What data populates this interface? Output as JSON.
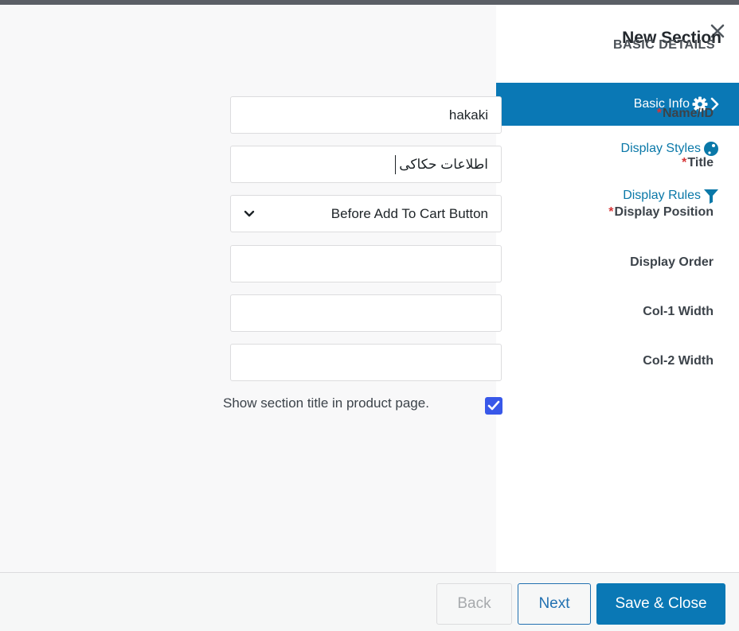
{
  "modal": {
    "title": "New Section",
    "section_heading": "BASIC DETAILS"
  },
  "nav": {
    "items": [
      {
        "label": "Basic Info",
        "icon": "gear-icon",
        "active": true
      },
      {
        "label": "Display Styles",
        "icon": "palette-icon",
        "active": false
      },
      {
        "label": "Display Rules",
        "icon": "funnel-icon",
        "active": false
      }
    ]
  },
  "form": {
    "fields": [
      {
        "label": "Name/ID",
        "required": true,
        "value": "hakaki"
      },
      {
        "label": "Title",
        "required": true,
        "value": "اطلاعات حکاکی"
      },
      {
        "label": "Display Position",
        "required": true,
        "value": "Before Add To Cart Button"
      },
      {
        "label": "Display Order",
        "required": false,
        "value": ""
      },
      {
        "label": "Col-1 Width",
        "required": false,
        "value": ""
      },
      {
        "label": "Col-2 Width",
        "required": false,
        "value": ""
      }
    ],
    "required_marker": "*",
    "show_title_label": "Show section title in product page.",
    "show_title_checked": true
  },
  "footer": {
    "back_label": "Back",
    "next_label": "Next",
    "save_label": "Save & Close"
  },
  "colors": {
    "accent": "#0a78b5",
    "checkbox": "#3858e9",
    "required": "#d63638",
    "nav_link": "#0a78a8"
  }
}
